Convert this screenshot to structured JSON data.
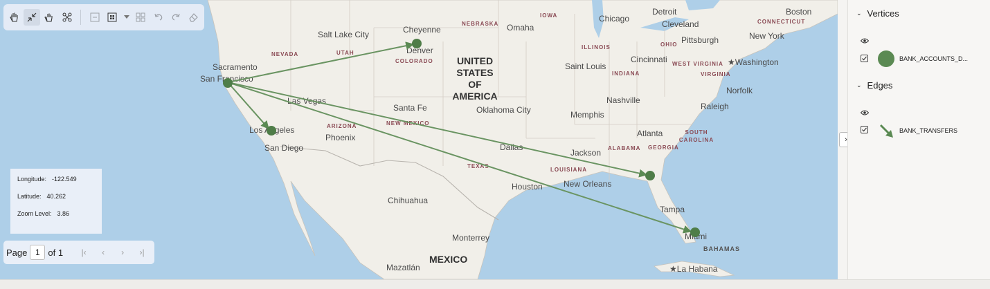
{
  "map": {
    "cities": [
      {
        "name": "Salt Lake City"
      },
      {
        "name": "Cheyenne"
      },
      {
        "name": "Denver"
      },
      {
        "name": "Omaha"
      },
      {
        "name": "Chicago"
      },
      {
        "name": "Detroit"
      },
      {
        "name": "Boston"
      },
      {
        "name": "Cleveland"
      },
      {
        "name": "Pittsburgh"
      },
      {
        "name": "New York"
      },
      {
        "name": "Sacramento"
      },
      {
        "name": "San Francisco"
      },
      {
        "name": "Saint Louis"
      },
      {
        "name": "Cincinnati"
      },
      {
        "name": "Washington"
      },
      {
        "name": "Las Vegas"
      },
      {
        "name": "Santa Fe"
      },
      {
        "name": "Oklahoma City"
      },
      {
        "name": "Nashville"
      },
      {
        "name": "Norfolk"
      },
      {
        "name": "Memphis"
      },
      {
        "name": "Raleigh"
      },
      {
        "name": "Los Angeles"
      },
      {
        "name": "Atlanta"
      },
      {
        "name": "San Diego"
      },
      {
        "name": "Phoenix"
      },
      {
        "name": "Dallas"
      },
      {
        "name": "Jackson"
      },
      {
        "name": "Houston"
      },
      {
        "name": "New Orleans"
      },
      {
        "name": "Chihuahua"
      },
      {
        "name": "Tampa"
      },
      {
        "name": "Monterrey"
      },
      {
        "name": "Miami"
      },
      {
        "name": "Mazatlán"
      },
      {
        "name": "La Habana"
      }
    ],
    "states": [
      "NEBRASKA",
      "IOWA",
      "NEVADA",
      "UTAH",
      "ILLINOIS",
      "OHIO",
      "CONNECTICUT",
      "COLORADO",
      "INDIANA",
      "WEST VIRGINIA",
      "VIRGINIA",
      "ARIZONA",
      "NEW MEXICO",
      "SOUTH CAROLINA",
      "ALABAMA",
      "GEORGIA",
      "TEXAS",
      "LOUISIANA"
    ],
    "countries": [
      "UNITED\nSTATES OF\nAMERICA",
      "MEXICO"
    ],
    "seas": [
      "BAHAMAS"
    ],
    "accent_color": "#5b8a53",
    "vertices": [
      "San Francisco",
      "Denver",
      "Los Angeles",
      "Tallahassee area",
      "Miami"
    ],
    "edges": [
      [
        "San Francisco",
        "Denver"
      ],
      [
        "San Francisco",
        "Los Angeles"
      ],
      [
        "San Francisco",
        "Tallahassee area"
      ],
      [
        "San Francisco",
        "Miami"
      ]
    ]
  },
  "toolbar": {
    "icons": [
      "pan-hand-icon",
      "collapse-icon",
      "select-hand-icon",
      "network-icon",
      "minus-box-icon",
      "grid-box-icon",
      "dropdown-arrow-icon",
      "layout-icon",
      "undo-icon",
      "redo-icon",
      "eraser-icon"
    ]
  },
  "coords": {
    "lon_label": "Longitude:",
    "lon_value": "-122.549",
    "lat_label": "Latitude:",
    "lat_value": "40.262",
    "zoom_label": "Zoom Level:",
    "zoom_value": "3.86"
  },
  "pager": {
    "page_label": "Page",
    "page_value": "1",
    "of_label": "of 1"
  },
  "panel": {
    "vertices_title": "Vertices",
    "vertex_label": "BANK_ACCOUNTS_D...",
    "edges_title": "Edges",
    "edge_label": "BANK_TRANSFERS"
  }
}
